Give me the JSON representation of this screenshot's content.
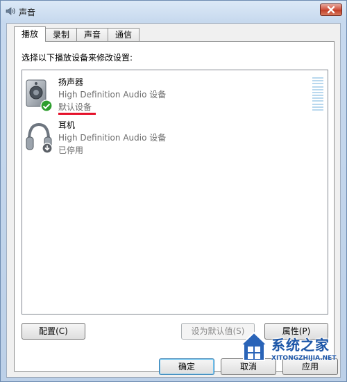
{
  "window": {
    "title": "声音"
  },
  "tabs": [
    {
      "label": "播放",
      "active": true
    },
    {
      "label": "录制",
      "active": false
    },
    {
      "label": "声音",
      "active": false
    },
    {
      "label": "通信",
      "active": false
    }
  ],
  "panel": {
    "instruction": "选择以下播放设备来修改设置:"
  },
  "devices": [
    {
      "name": "扬声器",
      "description": "High Definition Audio 设备",
      "status": "默认设备",
      "icon": "speaker-icon",
      "badge": "default-check-icon"
    },
    {
      "name": "耳机",
      "description": "High Definition Audio 设备",
      "status": "已停用",
      "icon": "headphones-icon",
      "badge": "disabled-arrow-icon"
    }
  ],
  "buttons": {
    "configure": "配置(C)",
    "set_default": "设为默认值(S)",
    "properties": "属性(P)",
    "ok": "确定",
    "cancel": "取消",
    "apply": "应用"
  },
  "watermark": {
    "text": "系统之家",
    "url_text": "XITONGZHIJIA.NET"
  },
  "colors": {
    "accent_underline": "#e5112a",
    "check_green": "#2e9e2e"
  }
}
